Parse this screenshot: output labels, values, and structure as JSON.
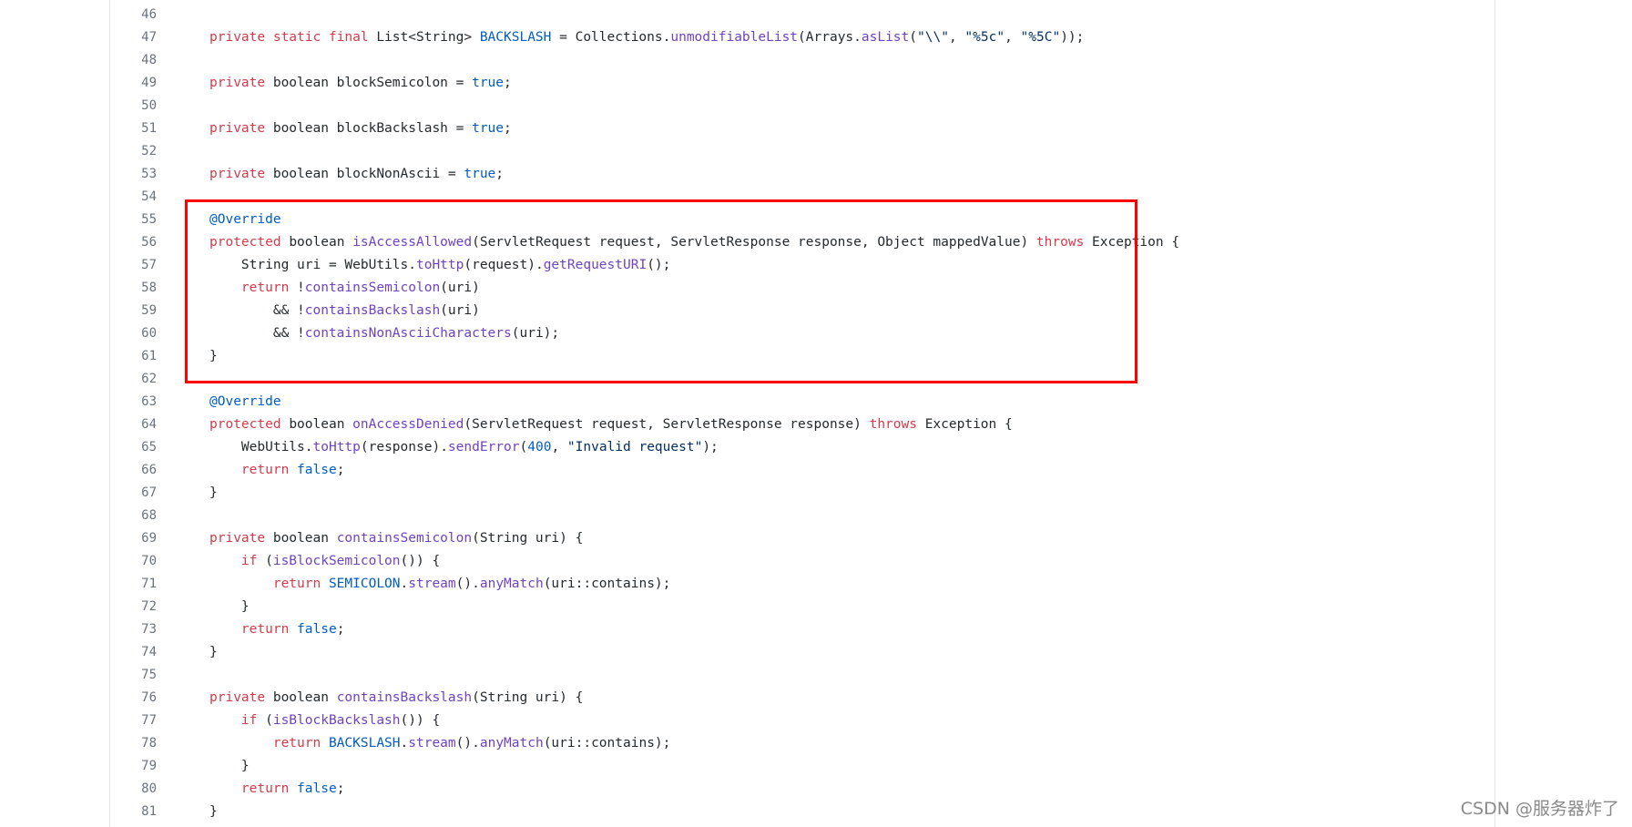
{
  "colors": {
    "keyword": "#d73a49",
    "function": "#6f42c1",
    "constant": "#005cc5",
    "string": "#032f62",
    "text": "#24292e",
    "line_number": "#6a737d",
    "highlight": "#ff0000"
  },
  "lines": [
    {
      "num": "46",
      "tokens": []
    },
    {
      "num": "47",
      "tokens": [
        [
          "kw",
          "private static final "
        ],
        [
          "tx",
          "List<String> "
        ],
        [
          "cn",
          "BACKSLASH"
        ],
        [
          "tx",
          " = Collections."
        ],
        [
          "fn",
          "unmodifiableList"
        ],
        [
          "tx",
          "(Arrays."
        ],
        [
          "fn",
          "asList"
        ],
        [
          "tx",
          "("
        ],
        [
          "st",
          "\"\\\\\""
        ],
        [
          "tx",
          ", "
        ],
        [
          "st",
          "\"%5c\""
        ],
        [
          "tx",
          ", "
        ],
        [
          "st",
          "\"%5C\""
        ],
        [
          "tx",
          "));"
        ]
      ]
    },
    {
      "num": "48",
      "tokens": []
    },
    {
      "num": "49",
      "tokens": [
        [
          "kw",
          "private "
        ],
        [
          "tx",
          "boolean blockSemicolon = "
        ],
        [
          "cn",
          "true"
        ],
        [
          "tx",
          ";"
        ]
      ]
    },
    {
      "num": "50",
      "tokens": []
    },
    {
      "num": "51",
      "tokens": [
        [
          "kw",
          "private "
        ],
        [
          "tx",
          "boolean blockBackslash = "
        ],
        [
          "cn",
          "true"
        ],
        [
          "tx",
          ";"
        ]
      ]
    },
    {
      "num": "52",
      "tokens": []
    },
    {
      "num": "53",
      "tokens": [
        [
          "kw",
          "private "
        ],
        [
          "tx",
          "boolean blockNonAscii = "
        ],
        [
          "cn",
          "true"
        ],
        [
          "tx",
          ";"
        ]
      ]
    },
    {
      "num": "54",
      "tokens": []
    },
    {
      "num": "55",
      "tokens": [
        [
          "an",
          "@Override"
        ]
      ]
    },
    {
      "num": "56",
      "tokens": [
        [
          "kw",
          "protected "
        ],
        [
          "tx",
          "boolean "
        ],
        [
          "fn",
          "isAccessAllowed"
        ],
        [
          "tx",
          "(ServletRequest request, ServletResponse response, Object mappedValue) "
        ],
        [
          "kw",
          "throws "
        ],
        [
          "tx",
          "Exception {"
        ]
      ]
    },
    {
      "num": "57",
      "tokens": [
        [
          "tx",
          "    String uri = WebUtils."
        ],
        [
          "fn",
          "toHttp"
        ],
        [
          "tx",
          "(request)."
        ],
        [
          "fn",
          "getRequestURI"
        ],
        [
          "tx",
          "();"
        ]
      ]
    },
    {
      "num": "58",
      "tokens": [
        [
          "kw",
          "    return "
        ],
        [
          "tx",
          "!"
        ],
        [
          "fn",
          "containsSemicolon"
        ],
        [
          "tx",
          "(uri)"
        ]
      ]
    },
    {
      "num": "59",
      "tokens": [
        [
          "tx",
          "        && !"
        ],
        [
          "fn",
          "containsBackslash"
        ],
        [
          "tx",
          "(uri)"
        ]
      ]
    },
    {
      "num": "60",
      "tokens": [
        [
          "tx",
          "        && !"
        ],
        [
          "fn",
          "containsNonAsciiCharacters"
        ],
        [
          "tx",
          "(uri);"
        ]
      ]
    },
    {
      "num": "61",
      "tokens": [
        [
          "tx",
          "}"
        ]
      ]
    },
    {
      "num": "62",
      "tokens": []
    },
    {
      "num": "63",
      "tokens": [
        [
          "an",
          "@Override"
        ]
      ]
    },
    {
      "num": "64",
      "tokens": [
        [
          "kw",
          "protected "
        ],
        [
          "tx",
          "boolean "
        ],
        [
          "fn",
          "onAccessDenied"
        ],
        [
          "tx",
          "(ServletRequest request, ServletResponse response) "
        ],
        [
          "kw",
          "throws "
        ],
        [
          "tx",
          "Exception {"
        ]
      ]
    },
    {
      "num": "65",
      "tokens": [
        [
          "tx",
          "    WebUtils."
        ],
        [
          "fn",
          "toHttp"
        ],
        [
          "tx",
          "(response)."
        ],
        [
          "fn",
          "sendError"
        ],
        [
          "tx",
          "("
        ],
        [
          "cn",
          "400"
        ],
        [
          "tx",
          ", "
        ],
        [
          "st",
          "\"Invalid request\""
        ],
        [
          "tx",
          ");"
        ]
      ]
    },
    {
      "num": "66",
      "tokens": [
        [
          "kw",
          "    return "
        ],
        [
          "cn",
          "false"
        ],
        [
          "tx",
          ";"
        ]
      ]
    },
    {
      "num": "67",
      "tokens": [
        [
          "tx",
          "}"
        ]
      ]
    },
    {
      "num": "68",
      "tokens": []
    },
    {
      "num": "69",
      "tokens": [
        [
          "kw",
          "private "
        ],
        [
          "tx",
          "boolean "
        ],
        [
          "fn",
          "containsSemicolon"
        ],
        [
          "tx",
          "(String uri) {"
        ]
      ]
    },
    {
      "num": "70",
      "tokens": [
        [
          "kw",
          "    if "
        ],
        [
          "tx",
          "("
        ],
        [
          "fn",
          "isBlockSemicolon"
        ],
        [
          "tx",
          "()) {"
        ]
      ]
    },
    {
      "num": "71",
      "tokens": [
        [
          "kw",
          "        return "
        ],
        [
          "cn",
          "SEMICOLON"
        ],
        [
          "tx",
          "."
        ],
        [
          "fn",
          "stream"
        ],
        [
          "tx",
          "()."
        ],
        [
          "fn",
          "anyMatch"
        ],
        [
          "tx",
          "(uri::contains);"
        ]
      ]
    },
    {
      "num": "72",
      "tokens": [
        [
          "tx",
          "    }"
        ]
      ]
    },
    {
      "num": "73",
      "tokens": [
        [
          "kw",
          "    return "
        ],
        [
          "cn",
          "false"
        ],
        [
          "tx",
          ";"
        ]
      ]
    },
    {
      "num": "74",
      "tokens": [
        [
          "tx",
          "}"
        ]
      ]
    },
    {
      "num": "75",
      "tokens": []
    },
    {
      "num": "76",
      "tokens": [
        [
          "kw",
          "private "
        ],
        [
          "tx",
          "boolean "
        ],
        [
          "fn",
          "containsBackslash"
        ],
        [
          "tx",
          "(String uri) {"
        ]
      ]
    },
    {
      "num": "77",
      "tokens": [
        [
          "kw",
          "    if "
        ],
        [
          "tx",
          "("
        ],
        [
          "fn",
          "isBlockBackslash"
        ],
        [
          "tx",
          "()) {"
        ]
      ]
    },
    {
      "num": "78",
      "tokens": [
        [
          "kw",
          "        return "
        ],
        [
          "cn",
          "BACKSLASH"
        ],
        [
          "tx",
          "."
        ],
        [
          "fn",
          "stream"
        ],
        [
          "tx",
          "()."
        ],
        [
          "fn",
          "anyMatch"
        ],
        [
          "tx",
          "(uri::contains);"
        ]
      ]
    },
    {
      "num": "79",
      "tokens": [
        [
          "tx",
          "    }"
        ]
      ]
    },
    {
      "num": "80",
      "tokens": [
        [
          "kw",
          "    return "
        ],
        [
          "cn",
          "false"
        ],
        [
          "tx",
          ";"
        ]
      ]
    },
    {
      "num": "81",
      "tokens": [
        [
          "tx",
          "}"
        ]
      ]
    }
  ],
  "watermark": "CSDN @服务器炸了"
}
